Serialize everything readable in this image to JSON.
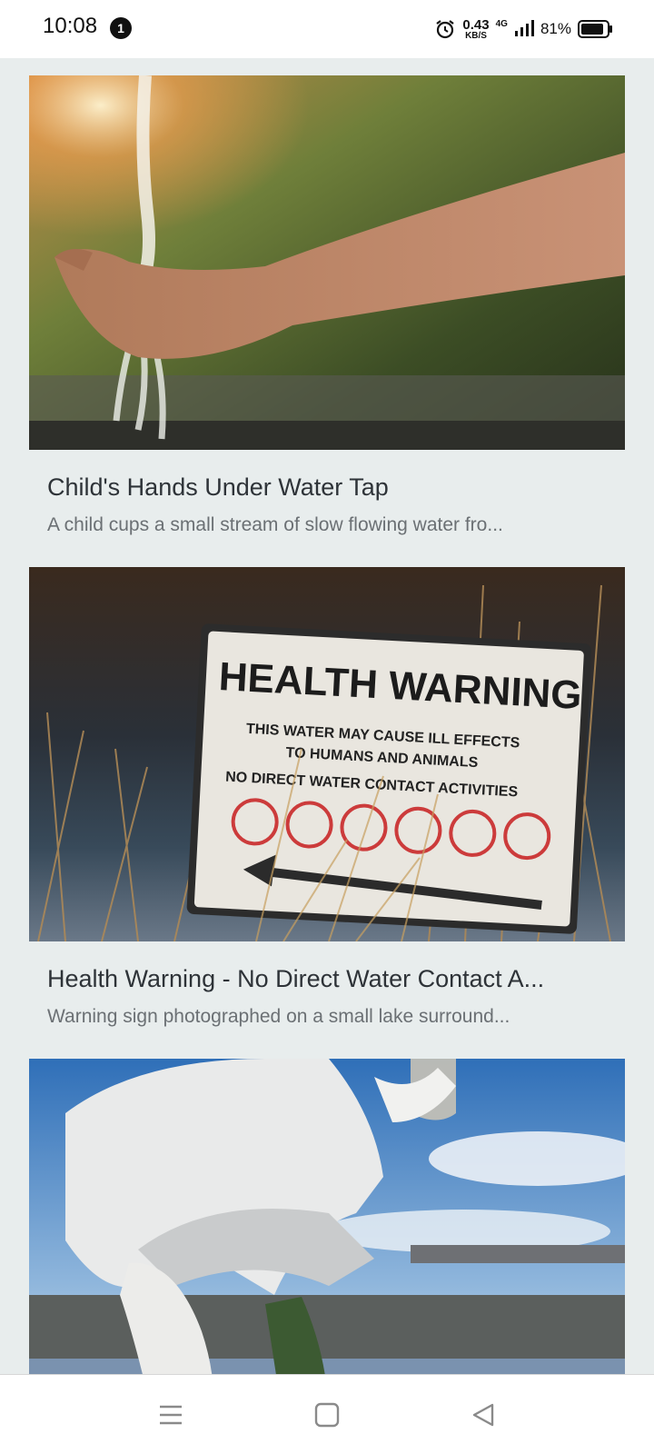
{
  "status_bar": {
    "time": "10:08",
    "notification_count": "1",
    "net_speed_value": "0.43",
    "net_speed_unit": "KB/S",
    "network_type": "4G",
    "battery_percent": "81%"
  },
  "cards": [
    {
      "title": "Child's Hands Under Water Tap",
      "description": "A child cups a small stream of slow flowing water fro...",
      "image_icon": "photo-water-tap"
    },
    {
      "title": "Health Warning - No Direct Water Contact A...",
      "description": "Warning sign photographed on a small lake surround...",
      "image_icon": "photo-health-warning-sign",
      "sign": {
        "heading": "HEALTH WARNING",
        "line1": "THIS WATER MAY CAUSE ILL EFFECTS",
        "line2": "TO HUMANS AND ANIMALS",
        "line3": "NO DIRECT WATER CONTACT ACTIVITIES"
      }
    },
    {
      "title": "",
      "description": "",
      "image_icon": "photo-water-sampling-worker"
    }
  ],
  "nav_bar": {
    "menu_icon": "menu-icon",
    "home_icon": "home-square-icon",
    "back_icon": "back-triangle-icon"
  }
}
